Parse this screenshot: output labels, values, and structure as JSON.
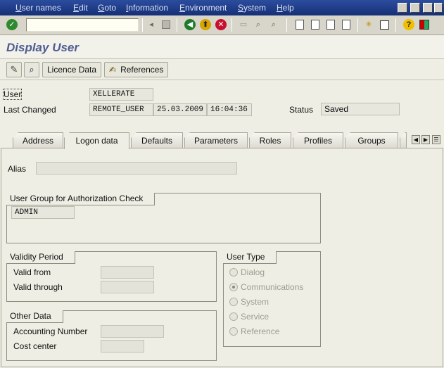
{
  "menubar": {
    "items": [
      "User names",
      "Edit",
      "Goto",
      "Information",
      "Environment",
      "System",
      "Help"
    ]
  },
  "toolbar": {
    "command_placeholder": "",
    "icons": [
      "enter-icon",
      "save-icon",
      "back-icon",
      "exit-icon",
      "cancel-icon",
      "print-icon",
      "find-icon",
      "find-next-icon",
      "first-page-icon",
      "previous-page-icon",
      "next-page-icon",
      "last-page-icon",
      "create-session-icon",
      "shortcut-icon",
      "help-icon",
      "layout-menu-icon"
    ]
  },
  "title": "Display User",
  "app_toolbar": {
    "licence_data_label": "Licence Data",
    "references_label": "References"
  },
  "header": {
    "user_label": "User",
    "user_value": "XELLERATE",
    "last_changed_label": "Last Changed",
    "last_changed_by": "REMOTE_USER",
    "last_changed_date": "25.03.2009",
    "last_changed_time": "16:04:36",
    "status_label": "Status",
    "status_value": "Saved"
  },
  "tabs": [
    {
      "label": "Address"
    },
    {
      "label": "Logon data"
    },
    {
      "label": "Defaults"
    },
    {
      "label": "Parameters"
    },
    {
      "label": "Roles"
    },
    {
      "label": "Profiles"
    },
    {
      "label": "Groups"
    }
  ],
  "logon_data": {
    "alias_label": "Alias",
    "alias_value": "",
    "auth_group_title": "User Group for Authorization Check",
    "auth_group_value": "ADMIN",
    "validity_title": "Validity Period",
    "valid_from_label": "Valid from",
    "valid_through_label": "Valid through",
    "other_title": "Other Data",
    "accounting_label": "Accounting Number",
    "cost_center_label": "Cost center",
    "user_type_title": "User Type",
    "user_types": [
      {
        "label": "Dialog",
        "checked": false
      },
      {
        "label": "Communications",
        "checked": true
      },
      {
        "label": "System",
        "checked": false
      },
      {
        "label": "Service",
        "checked": false
      },
      {
        "label": "Reference",
        "checked": false
      }
    ]
  }
}
